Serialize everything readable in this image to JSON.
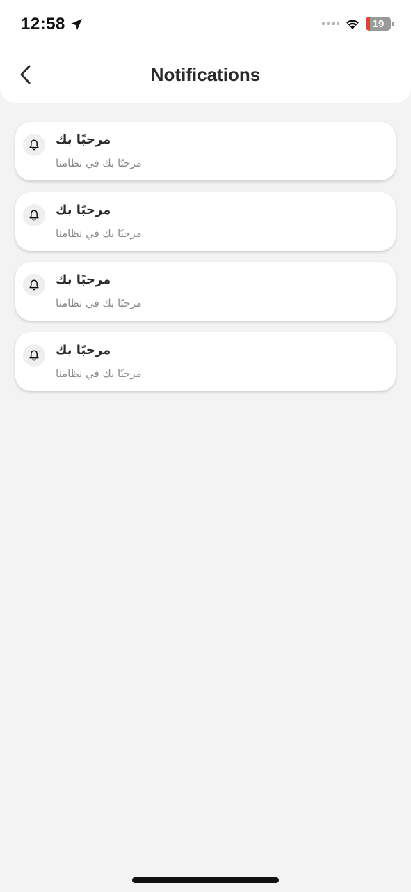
{
  "status_bar": {
    "time": "12:58",
    "battery_level": "19",
    "battery_color": "#e5403a"
  },
  "nav": {
    "title": "Notifications",
    "back_icon": "chevron-left-icon"
  },
  "notifications": [
    {
      "icon": "bell-icon",
      "title": "مرحبًا بك",
      "body": "مرحبًا بك في نظامنا"
    },
    {
      "icon": "bell-icon",
      "title": "مرحبًا بك",
      "body": "مرحبًا بك في نظامنا"
    },
    {
      "icon": "bell-icon",
      "title": "مرحبًا بك",
      "body": "مرحبًا بك في نظامنا"
    },
    {
      "icon": "bell-icon",
      "title": "مرحبًا بك",
      "body": "مرحبًا بك في نظامنا"
    }
  ]
}
